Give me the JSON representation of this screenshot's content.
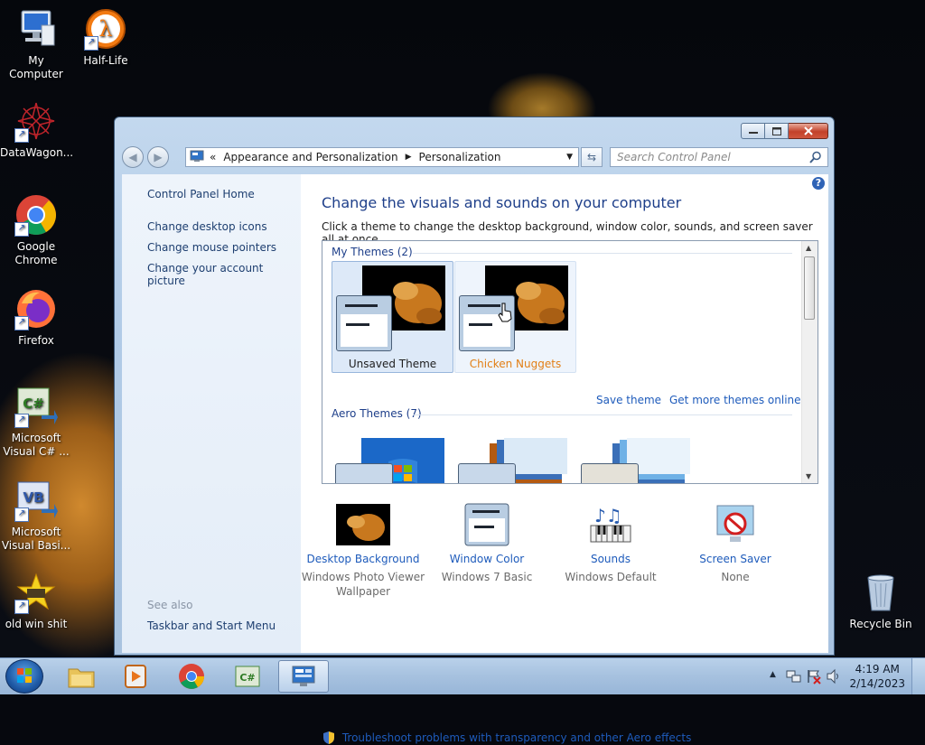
{
  "desktop": {
    "icons": [
      {
        "name": "My Computer"
      },
      {
        "name": "Half-Life"
      },
      {
        "name": "DataWagon..."
      },
      {
        "name": "Google Chrome"
      },
      {
        "name": "Firefox"
      },
      {
        "name": "Microsoft Visual C# ..."
      },
      {
        "name": "Microsoft Visual Basi..."
      },
      {
        "name": "old win shit"
      },
      {
        "name": "Recycle Bin"
      }
    ]
  },
  "window": {
    "breadcrumb": {
      "separator": "«",
      "items": [
        "Appearance and Personalization",
        "Personalization"
      ]
    },
    "search_placeholder": "Search Control Panel",
    "left_pane": {
      "home_link": "Control Panel Home",
      "links": [
        "Change desktop icons",
        "Change mouse pointers",
        "Change your account picture"
      ],
      "see_also_label": "See also",
      "see_also_links": [
        "Taskbar and Start Menu"
      ]
    },
    "main": {
      "heading": "Change the visuals and sounds on your computer",
      "subheading": "Click a theme to change the desktop background, window color, sounds, and screen saver all at once.",
      "my_themes_label": "My Themes (2)",
      "my_themes": [
        {
          "name": "Unsaved Theme",
          "state": "selected"
        },
        {
          "name": "Chicken Nuggets",
          "state": "hover"
        }
      ],
      "save_theme": "Save theme",
      "get_more_themes": "Get more themes online",
      "aero_themes_label": "Aero Themes (7)",
      "bottom_items": [
        {
          "title": "Desktop Background",
          "value": "Windows Photo Viewer Wallpaper"
        },
        {
          "title": "Window Color",
          "value": "Windows 7 Basic"
        },
        {
          "title": "Sounds",
          "value": "Windows Default"
        },
        {
          "title": "Screen Saver",
          "value": "None"
        }
      ],
      "troubleshoot_link": "Troubleshoot problems with transparency and other Aero effects"
    }
  },
  "taskbar": {
    "time": "4:19 AM",
    "date": "2/14/2023"
  },
  "colors": {
    "link": "#1e5bbb",
    "heading": "#1e3f8a",
    "hover_theme_name": "#e27f14"
  }
}
